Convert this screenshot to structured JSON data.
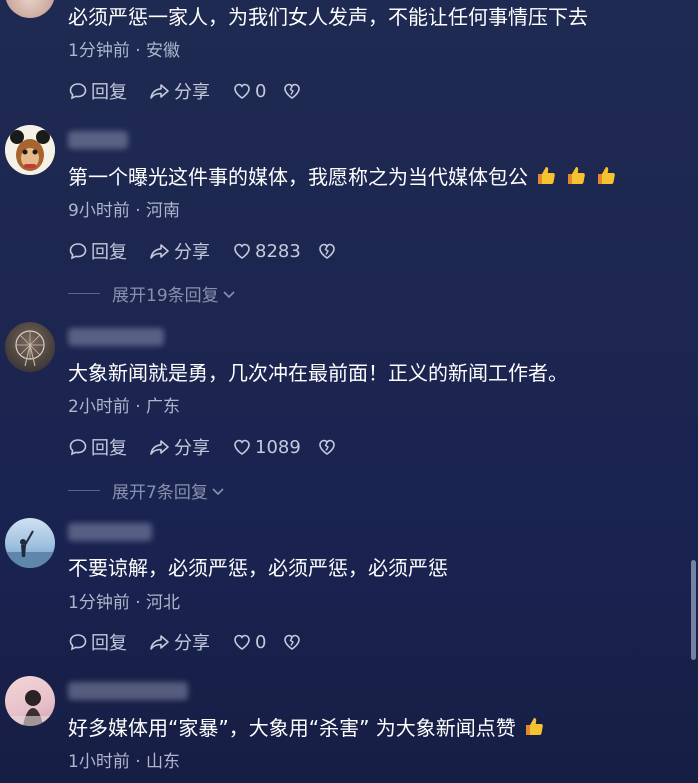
{
  "comments": [
    {
      "text": "必须严惩一家人，为我们女人发声，不能让任何事情压下去",
      "time": "1分钟前",
      "location": "安徽",
      "reply_label": "回复",
      "share_label": "分享",
      "likes": "0"
    },
    {
      "text": "第一个曝光这件事的媒体，我愿称之为当代媒体包公",
      "emoji": [
        "thumbs-up",
        "thumbs-up",
        "thumbs-up"
      ],
      "time": "9小时前",
      "location": "河南",
      "reply_label": "回复",
      "share_label": "分享",
      "likes": "8283",
      "expand": "展开19条回复"
    },
    {
      "text": "大象新闻就是勇，几次冲在最前面！正义的新闻工作者。",
      "time": "2小时前",
      "location": "广东",
      "reply_label": "回复",
      "share_label": "分享",
      "likes": "1089",
      "expand": "展开7条回复"
    },
    {
      "text": "不要谅解，必须严惩，必须严惩，必须严惩",
      "time": "1分钟前",
      "location": "河北",
      "reply_label": "回复",
      "share_label": "分享",
      "likes": "0"
    },
    {
      "text": "好多媒体用“家暴”，大象用“杀害” 为大象新闻点赞",
      "emoji": [
        "thumbs-up"
      ],
      "time": "1小时前",
      "location": "山东"
    }
  ],
  "colors": {
    "background": "#1c2650",
    "text": "#ffffff",
    "meta": "#aeb5cc",
    "action": "#c4c9dc"
  },
  "icons": [
    "comment-bubble-icon",
    "share-arrow-icon",
    "heart-icon",
    "broken-heart-icon",
    "chevron-down-icon",
    "thumbs-up-icon"
  ]
}
